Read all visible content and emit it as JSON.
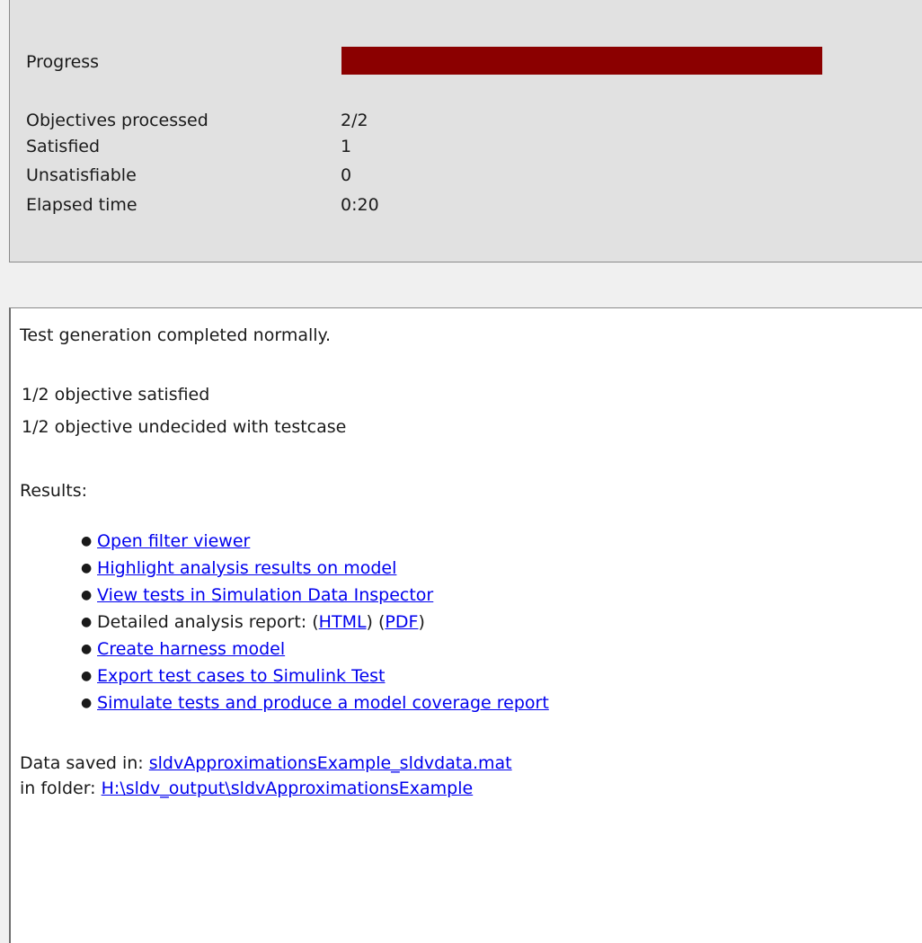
{
  "progress": {
    "label": "Progress",
    "fraction": 1.0,
    "bar_color": "#8b0000"
  },
  "stats": [
    {
      "label": "Objectives processed",
      "value": "2/2"
    },
    {
      "label": "Satisfied",
      "value": "1"
    },
    {
      "label": "Unsatisfiable",
      "value": "0"
    },
    {
      "label": "Elapsed time",
      "value": "0:20"
    }
  ],
  "results": {
    "status": "Test generation completed normally.",
    "summary": [
      "1/2 objective satisfied",
      "1/2 objective undecided with testcase"
    ],
    "results_heading": "Results:",
    "links": {
      "open_filter_viewer": "Open filter viewer",
      "highlight": "Highlight analysis results on model",
      "view_tests": "View tests in Simulation Data Inspector",
      "report_prefix": "Detailed analysis report: (",
      "report_html": "HTML",
      "report_mid": ") (",
      "report_pdf": "PDF",
      "report_suffix": ")",
      "create_harness": "Create harness model",
      "export_tests": "Export test cases to Simulink Test",
      "simulate_tests": "Simulate tests and produce a model coverage report"
    },
    "data_saved_label": "Data saved in: ",
    "data_file": "sldvApproximationsExample_sldvdata.mat",
    "folder_label": "in folder: ",
    "folder_path": "H:\\sldv_output\\sldvApproximationsExample",
    "link_color": "#0000ee"
  }
}
